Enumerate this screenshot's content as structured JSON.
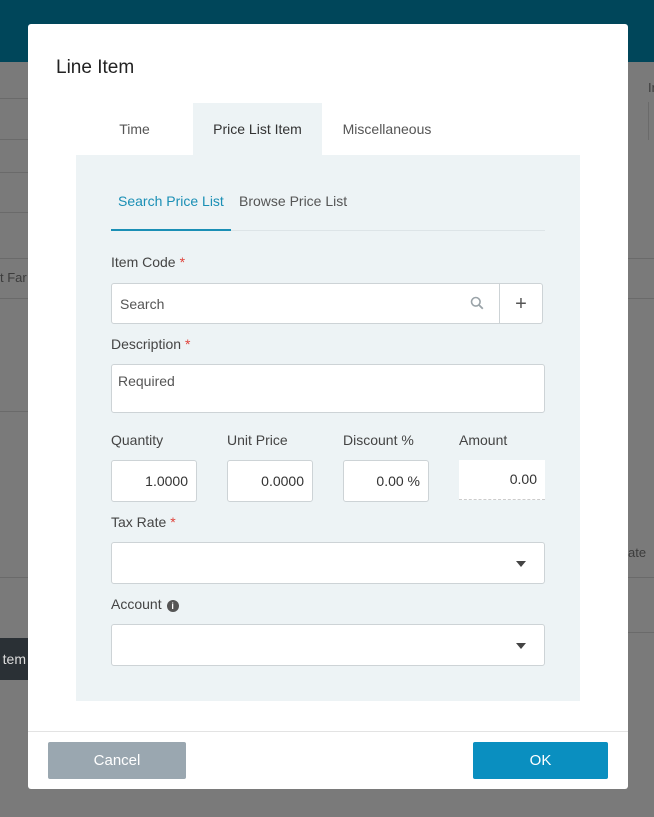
{
  "background": {
    "partial_texts": [
      "t Far",
      "Ir",
      "ate",
      "tem"
    ]
  },
  "modal": {
    "title": "Line Item",
    "tabs": [
      {
        "label": "Time",
        "active": false
      },
      {
        "label": "Price List Item",
        "active": true
      },
      {
        "label": "Miscellaneous",
        "active": false
      }
    ],
    "subtabs": [
      {
        "label": "Search Price List",
        "active": true
      },
      {
        "label": "Browse Price List",
        "active": false
      }
    ],
    "item_code": {
      "label": "Item Code",
      "required_mark": "*",
      "placeholder": "Search",
      "add_symbol": "+"
    },
    "description": {
      "label": "Description",
      "required_mark": "*",
      "placeholder": "Required"
    },
    "quantity": {
      "label": "Quantity",
      "value": "1.0000"
    },
    "unit_price": {
      "label": "Unit Price",
      "value": "0.0000"
    },
    "discount": {
      "label": "Discount %",
      "value": "0.00 %"
    },
    "amount": {
      "label": "Amount",
      "value": "0.00"
    },
    "tax_rate": {
      "label": "Tax Rate",
      "required_mark": "*",
      "value": ""
    },
    "account": {
      "label": "Account",
      "info_icon": "info-icon",
      "value": ""
    },
    "footer": {
      "cancel_label": "Cancel",
      "ok_label": "OK"
    }
  },
  "colors": {
    "topbar": "#00465a",
    "accent": "#1a8fb5",
    "ok_button": "#0a8fc0",
    "cancel_button": "#9aa7b0",
    "required": "#e0433b",
    "panel_bg": "#edf3f5"
  }
}
